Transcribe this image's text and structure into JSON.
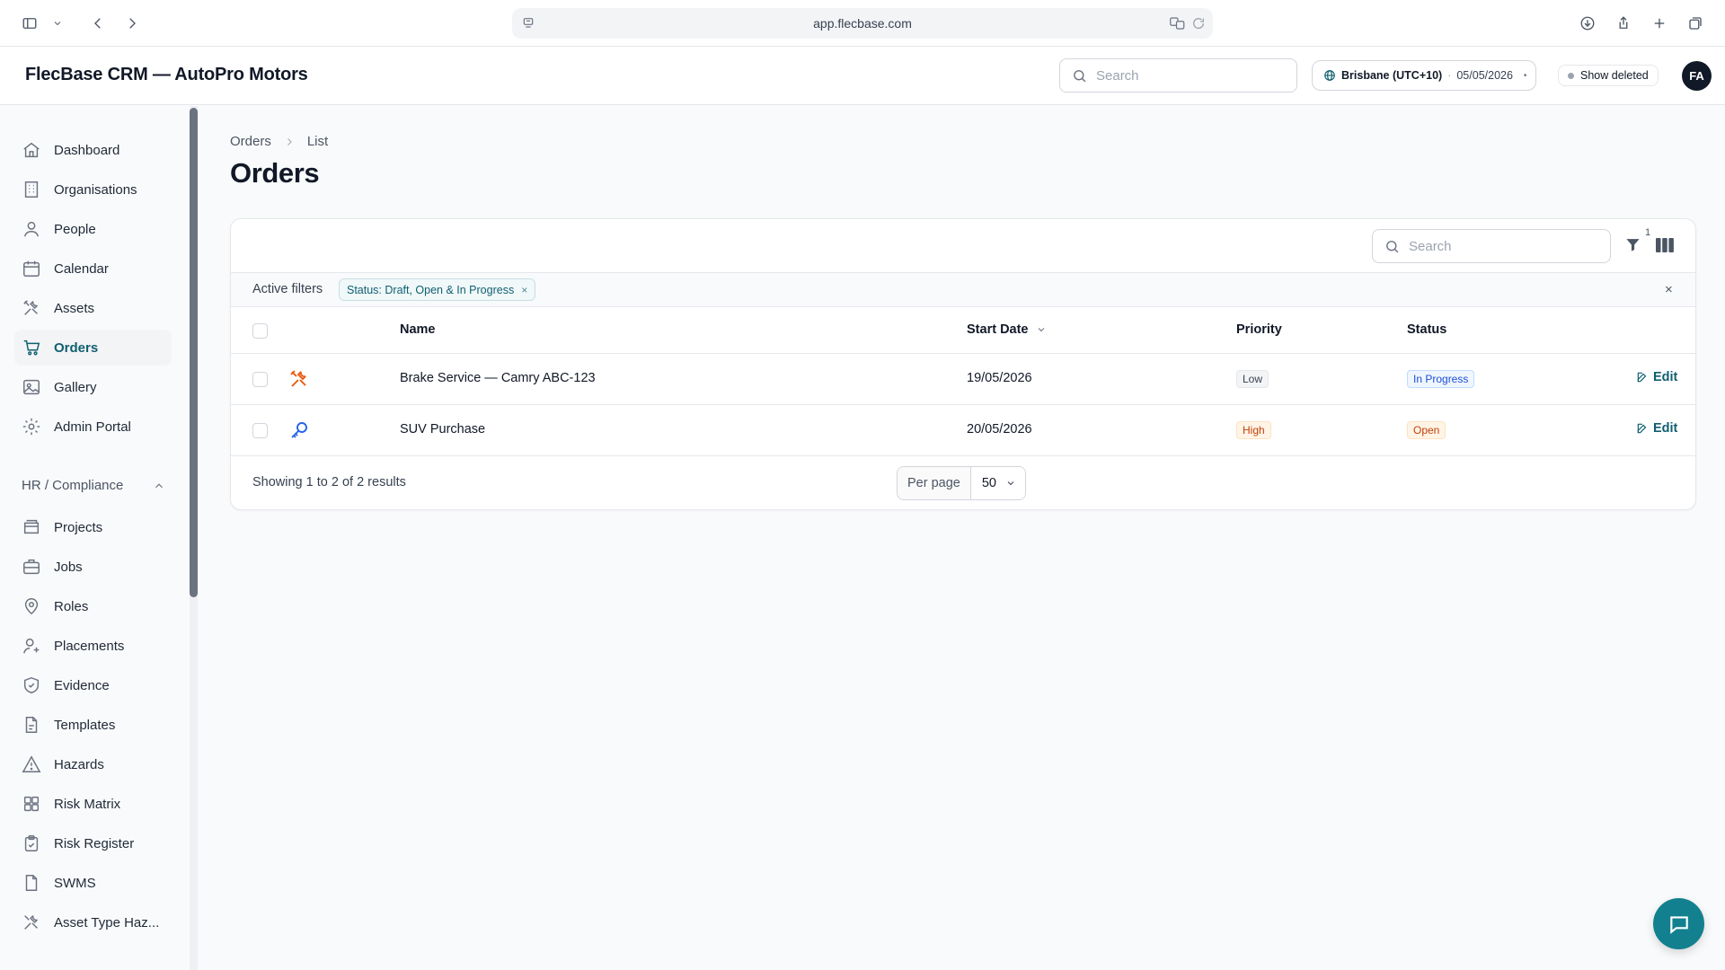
{
  "browser": {
    "url": "app.flecbase.com"
  },
  "app": {
    "title": "FlecBase CRM — AutoPro Motors",
    "search_placeholder": "Search",
    "timezone": "Brisbane (UTC+10)",
    "date": "05/05/2026",
    "show_deleted_label": "Show deleted",
    "avatar_initials": "FA"
  },
  "sidebar": {
    "items": [
      {
        "label": "Dashboard",
        "icon": "home-icon"
      },
      {
        "label": "Organisations",
        "icon": "building-icon"
      },
      {
        "label": "People",
        "icon": "user-icon"
      },
      {
        "label": "Calendar",
        "icon": "calendar-icon"
      },
      {
        "label": "Assets",
        "icon": "tools-icon"
      },
      {
        "label": "Orders",
        "icon": "cart-icon",
        "active": true
      },
      {
        "label": "Gallery",
        "icon": "image-icon"
      },
      {
        "label": "Admin Portal",
        "icon": "gear-icon"
      }
    ],
    "group_label": "HR / Compliance",
    "group_items": [
      {
        "label": "Projects",
        "icon": "folders-icon"
      },
      {
        "label": "Jobs",
        "icon": "briefcase-icon"
      },
      {
        "label": "Roles",
        "icon": "map-pin-icon"
      },
      {
        "label": "Placements",
        "icon": "user-plus-icon"
      },
      {
        "label": "Evidence",
        "icon": "shield-check-icon"
      },
      {
        "label": "Templates",
        "icon": "document-icon"
      },
      {
        "label": "Hazards",
        "icon": "warning-icon"
      },
      {
        "label": "Risk Matrix",
        "icon": "grid-icon"
      },
      {
        "label": "Risk Register",
        "icon": "clipboard-icon"
      },
      {
        "label": "SWMS",
        "icon": "document-icon"
      },
      {
        "label": "Asset Type Haz...",
        "icon": "tools-icon"
      }
    ]
  },
  "breadcrumb": {
    "root": "Orders",
    "current": "List"
  },
  "page": {
    "title": "Orders"
  },
  "table": {
    "search_placeholder": "Search",
    "filter_count": "1",
    "active_filters_label": "Active filters",
    "filter_chip": "Status: Draft, Open & In Progress",
    "filter_chip_remove": "×",
    "clear_filters": "×",
    "columns": {
      "name": "Name",
      "start_date": "Start Date",
      "priority": "Priority",
      "status": "Status"
    },
    "rows": [
      {
        "icon": "tools-icon",
        "icon_color": "#ea580c",
        "name": "Brake Service — Camry ABC-123",
        "start_date": "19/05/2026",
        "priority": "Low",
        "status": "In Progress",
        "edit_label": "Edit"
      },
      {
        "icon": "key-icon",
        "icon_color": "#2563eb",
        "name": "SUV Purchase",
        "start_date": "20/05/2026",
        "priority": "High",
        "status": "Open",
        "edit_label": "Edit"
      }
    ],
    "results_text": "Showing 1 to 2 of 2 results",
    "per_page_label": "Per page",
    "per_page_value": "50"
  },
  "colors": {
    "accent": "#0f5f70",
    "fab": "#12808f"
  }
}
